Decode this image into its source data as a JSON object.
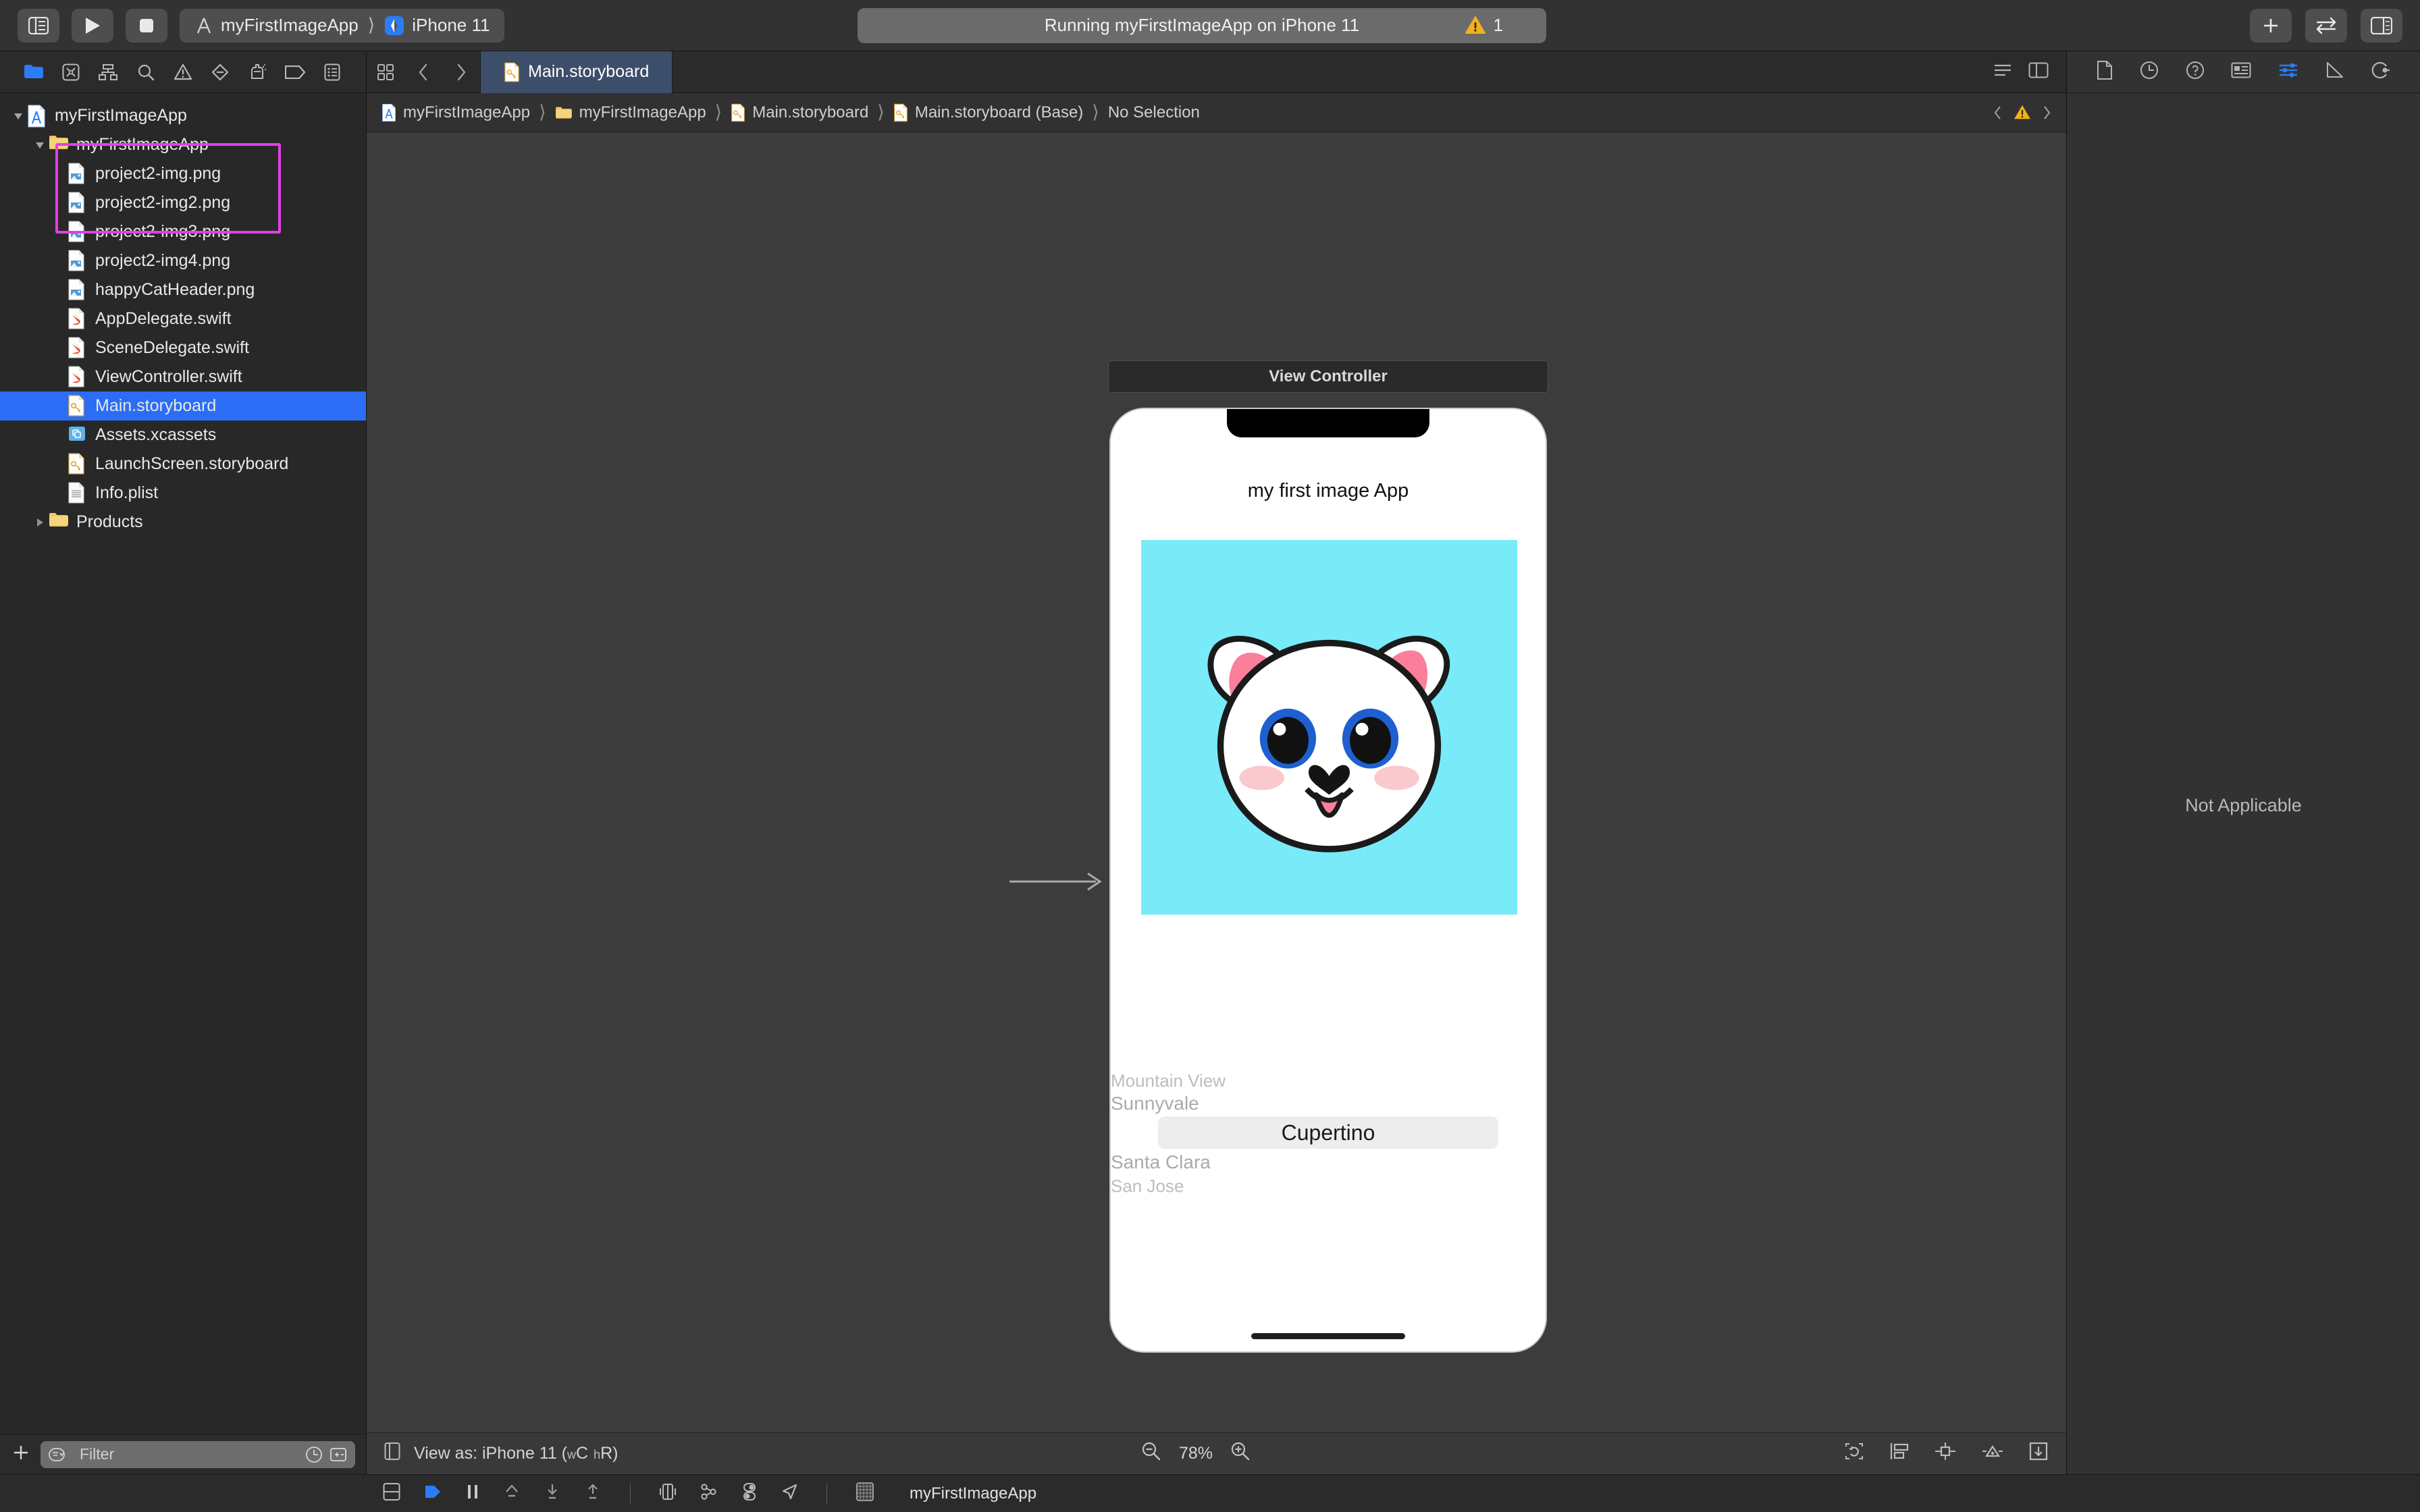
{
  "toolbar": {
    "sidebar_toggle": "sidebar-toggle",
    "run_label": "Run",
    "stop_label": "Stop",
    "scheme_name": "myFirstImageApp",
    "destination_name": "iPhone 11",
    "status_text": "Running myFirstImageApp on iPhone 11",
    "warning_count": "1",
    "add_label": "+",
    "assistant_label": "Assistant Editor",
    "inspector_toggle_label": "Toggle Inspector"
  },
  "navigator": {
    "toolbar_icons": [
      "project-navigator-icon",
      "source-control-navigator-icon",
      "symbol-navigator-icon",
      "find-navigator-icon",
      "issue-navigator-icon",
      "test-navigator-icon",
      "debug-navigator-icon",
      "breakpoint-navigator-icon",
      "report-navigator-icon"
    ],
    "tree": [
      {
        "label": "myFirstImageApp",
        "icon": "xcode-project-icon",
        "indent": 0,
        "twisty": "down",
        "selected": false
      },
      {
        "label": "myFirstImageApp",
        "icon": "folder-icon",
        "indent": 1,
        "twisty": "down",
        "selected": false
      },
      {
        "label": "project2-img.png",
        "icon": "png-file-icon",
        "indent": 2,
        "twisty": "none",
        "selected": false
      },
      {
        "label": "project2-img2.png",
        "icon": "png-file-icon",
        "indent": 2,
        "twisty": "none",
        "selected": false
      },
      {
        "label": "project2-img3.png",
        "icon": "png-file-icon",
        "indent": 2,
        "twisty": "none",
        "selected": false
      },
      {
        "label": "project2-img4.png",
        "icon": "png-file-icon",
        "indent": 2,
        "twisty": "none",
        "selected": false
      },
      {
        "label": "happyCatHeader.png",
        "icon": "png-file-icon",
        "indent": 2,
        "twisty": "none",
        "selected": false
      },
      {
        "label": "AppDelegate.swift",
        "icon": "swift-file-icon",
        "indent": 2,
        "twisty": "none",
        "selected": false
      },
      {
        "label": "SceneDelegate.swift",
        "icon": "swift-file-icon",
        "indent": 2,
        "twisty": "none",
        "selected": false
      },
      {
        "label": "ViewController.swift",
        "icon": "swift-file-icon",
        "indent": 2,
        "twisty": "none",
        "selected": false
      },
      {
        "label": "Main.storyboard",
        "icon": "storyboard-file-icon",
        "indent": 2,
        "twisty": "none",
        "selected": true
      },
      {
        "label": "Assets.xcassets",
        "icon": "xcassets-icon",
        "indent": 2,
        "twisty": "none",
        "selected": false
      },
      {
        "label": "LaunchScreen.storyboard",
        "icon": "storyboard-file-icon",
        "indent": 2,
        "twisty": "none",
        "selected": false
      },
      {
        "label": "Info.plist",
        "icon": "plist-file-icon",
        "indent": 2,
        "twisty": "none",
        "selected": false
      },
      {
        "label": "Products",
        "icon": "folder-icon",
        "indent": 1,
        "twisty": "right",
        "selected": false
      }
    ],
    "highlight_color": "#e040e8",
    "filter_placeholder": "Filter",
    "add_button_label": "+"
  },
  "editor": {
    "tab_label": "Main.storyboard",
    "breadcrumb": [
      {
        "label": "myFirstImageApp",
        "icon": "xcode-project-icon"
      },
      {
        "label": "myFirstImageApp",
        "icon": "folder-icon"
      },
      {
        "label": "Main.storyboard",
        "icon": "storyboard-file-icon"
      },
      {
        "label": "Main.storyboard (Base)",
        "icon": "storyboard-file-icon"
      },
      {
        "label": "No Selection",
        "icon": "none"
      }
    ],
    "breadcrumb_warning": "1",
    "view_as_label": "View as: iPhone 11 (",
    "view_as_w": "w",
    "view_as_c": "C",
    "view_as_h": "h",
    "view_as_r": "R)",
    "zoom_level": "78%",
    "zoom_out_label": "Zoom Out",
    "zoom_in_label": "Zoom In"
  },
  "storyboard": {
    "scene_label": "View Controller",
    "app_title": "my first image App",
    "image_bg_color": "#79eaf7",
    "image_asset_name": "happy-cat-image",
    "picker": {
      "items": [
        "Mountain View",
        "Sunnyvale",
        "Cupertino",
        "Santa Clara",
        "San Jose"
      ],
      "selected_index": 2,
      "selected_value": "Cupertino"
    }
  },
  "inspector": {
    "tabs": [
      "file-inspector-icon",
      "history-inspector-icon",
      "quick-help-inspector-icon",
      "identity-inspector-icon",
      "attributes-inspector-icon",
      "size-inspector-icon",
      "connections-inspector-icon"
    ],
    "active_tab_index": 4,
    "empty_message": "Not Applicable"
  },
  "bottombar": {
    "icons": [
      "hide-debug-area-icon",
      "continue-icon",
      "pause-icon",
      "step-over-icon",
      "step-into-icon",
      "step-out-icon",
      "debug-view-hierarchy-icon",
      "debug-memory-graph-icon",
      "environment-overrides-icon",
      "simulate-location-icon"
    ],
    "process_icon": "app-thumbnail-icon",
    "process_label": "myFirstImageApp"
  }
}
